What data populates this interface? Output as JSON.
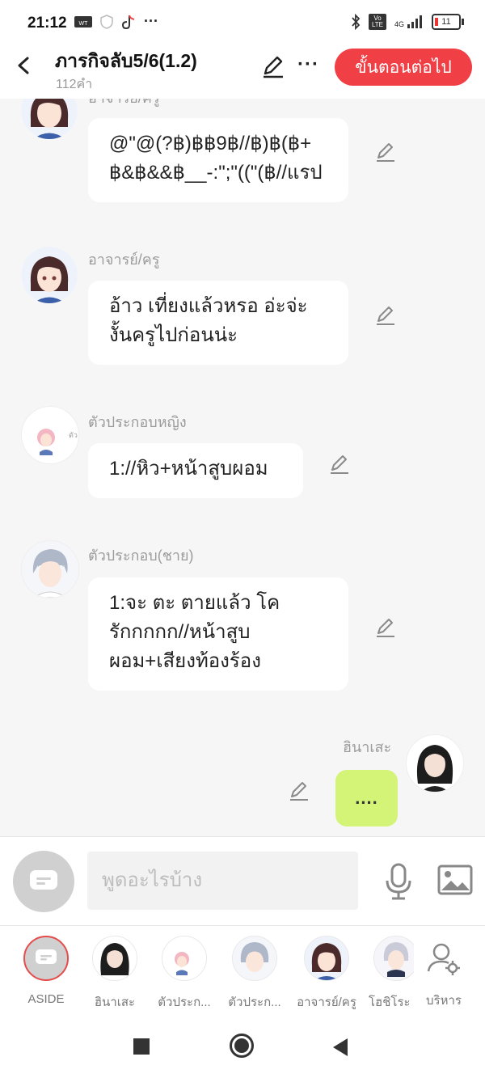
{
  "status_bar": {
    "time": "21:12",
    "battery": "11",
    "network": "4G",
    "volte": "Vo LTE"
  },
  "header": {
    "title": "ภารกิจลับ5/6(1.2)",
    "subtitle": "112คำ",
    "next_button": "ขั้นตอนต่อไป",
    "more": "···"
  },
  "messages": [
    {
      "speaker": "อาจารย์/ครู",
      "lines": [
        "@\"@(?฿)฿฿9฿//฿)฿(฿+",
        "฿&฿&&฿__-:\";\"((\"(฿//แรป"
      ]
    },
    {
      "speaker": "อาจารย์/ครู",
      "lines": [
        "อ้าว เที่ยงแล้วหรอ อ่ะจ่ะ",
        "งั้นครูไปก่อนน่ะ"
      ]
    },
    {
      "speaker": "ตัวประกอบหญิง",
      "lines": [
        "1://หิว+หน้าสูบผอม"
      ]
    },
    {
      "speaker": "ตัวประกอบ(ชาย)",
      "lines": [
        "1:จะ  ตะ ตายแล้ว โค",
        "รักกกกก//หน้าสูบ",
        "ผอม+เสียงท้องร้อง"
      ]
    }
  ],
  "my_message": {
    "speaker": "ฮินาเสะ",
    "text": "...."
  },
  "input": {
    "placeholder": "พูดอะไรบ้าง"
  },
  "characters": [
    {
      "label": "ASIDE"
    },
    {
      "label": "ฮินาเสะ"
    },
    {
      "label": "ตัวประก..."
    },
    {
      "label": "ตัวประก..."
    },
    {
      "label": "อาจารย์/ครู"
    },
    {
      "label": "โฮชิโระ"
    },
    {
      "label": "บริหาร"
    }
  ],
  "colors": {
    "accent": "#f04046",
    "my_bubble": "#d4f478",
    "background": "#f6f6f6"
  }
}
